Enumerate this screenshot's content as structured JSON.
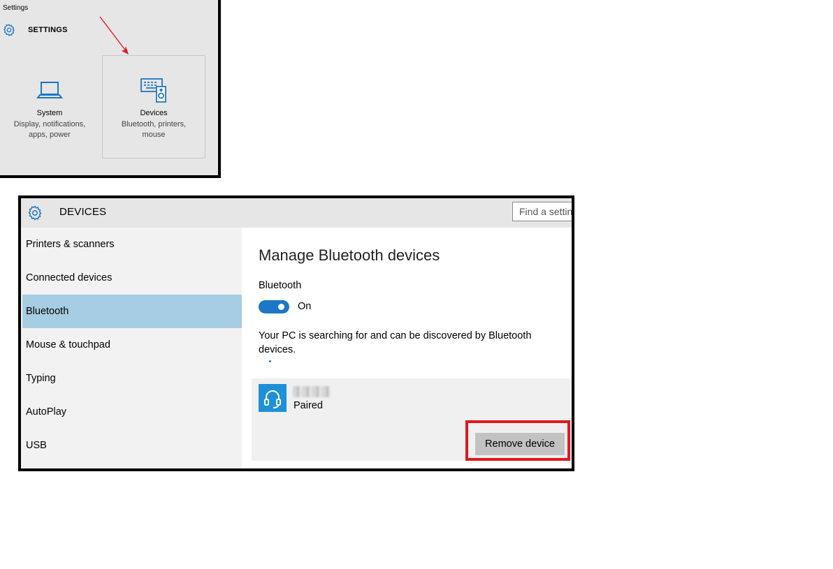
{
  "top_panel": {
    "window_title": "Settings",
    "heading": "SETTINGS",
    "tiles": [
      {
        "name": "System",
        "desc_line1": "Display, notifications,",
        "desc_line2": "apps, power",
        "icon": "laptop-icon"
      },
      {
        "name": "Devices",
        "desc_line1": "Bluetooth, printers,",
        "desc_line2": "mouse",
        "icon": "devices-icon"
      }
    ]
  },
  "window": {
    "heading": "DEVICES",
    "search": {
      "placeholder": "Find a setting"
    },
    "sidebar": {
      "items": [
        {
          "label": "Printers & scanners"
        },
        {
          "label": "Connected devices"
        },
        {
          "label": "Bluetooth",
          "selected": true
        },
        {
          "label": "Mouse & touchpad"
        },
        {
          "label": "Typing"
        },
        {
          "label": "AutoPlay"
        },
        {
          "label": "USB"
        }
      ]
    },
    "content": {
      "title": "Manage Bluetooth devices",
      "bluetooth_label": "Bluetooth",
      "toggle_state": "On",
      "search_message": "Your PC is searching for and can be discovered by Bluetooth devices.",
      "device": {
        "status": "Paired",
        "icon": "headset-icon"
      },
      "remove_button": "Remove device"
    }
  },
  "colors": {
    "accent": "#1c77c7",
    "selected_nav": "#a6cde3",
    "highlight": "#e0181e",
    "arrow": "#e0181e"
  }
}
